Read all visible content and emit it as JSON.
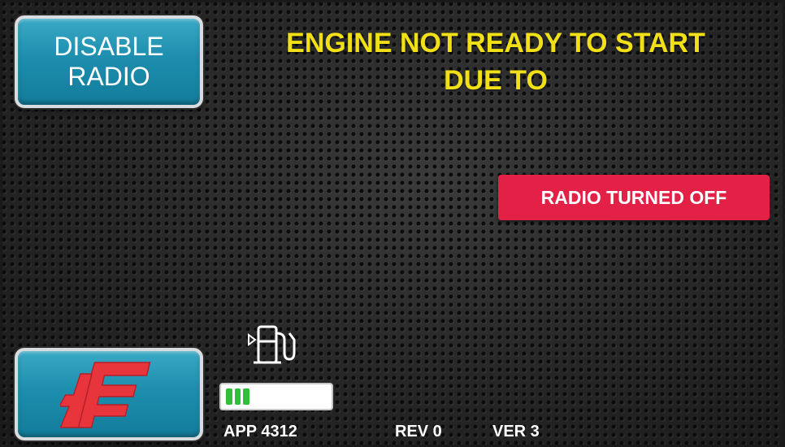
{
  "buttons": {
    "disable_radio": {
      "line1": "DISABLE",
      "line2": "RADIO"
    },
    "logo": {
      "icon": "brand-logo-icon",
      "color": "#e8343b"
    }
  },
  "header": {
    "line1": "ENGINE NOT READY TO START",
    "line2": "DUE TO",
    "color": "#f2e017"
  },
  "alerts": [
    {
      "text": "RADIO TURNED OFF",
      "color": "#e32046"
    }
  ],
  "fuel": {
    "icon": "fuel-pump-icon",
    "level_cells": 3,
    "total_cells": 12,
    "bar_color": "#2fbf3a"
  },
  "footer": {
    "app": "APP  4312",
    "rev": "REV 0",
    "ver": "VER 3"
  }
}
